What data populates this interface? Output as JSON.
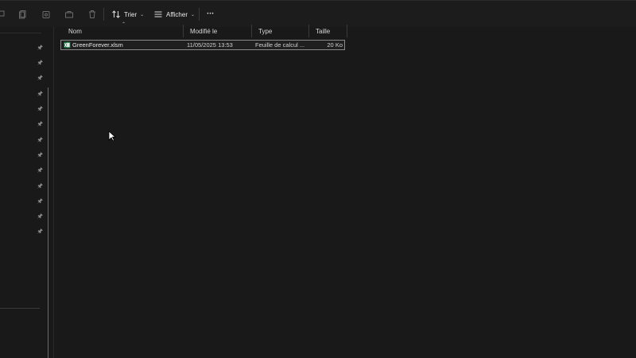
{
  "toolbar": {
    "sort_label": "Trier",
    "view_label": "Afficher",
    "more_label": "•••"
  },
  "columns": {
    "name": "Nom",
    "modified": "Modifié le",
    "type": "Type",
    "size": "Taille"
  },
  "files": [
    {
      "name": "GreenForever.xlsm",
      "modified": "11/05/2025 13:53",
      "type": "Feuille de calcul ...",
      "size": "20 Ko",
      "icon": "excel-file-icon"
    }
  ],
  "colors": {
    "background": "#191919",
    "accent_excel": "#1d6f42"
  }
}
